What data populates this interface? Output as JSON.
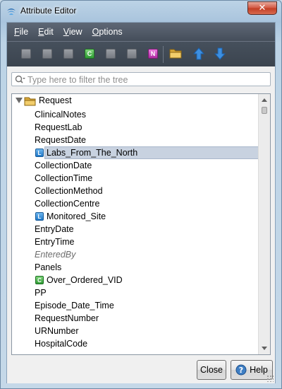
{
  "window": {
    "title": "Attribute Editor",
    "close_glyph": "✕"
  },
  "menu": [
    {
      "underline": "F",
      "rest": "ile"
    },
    {
      "underline": "E",
      "rest": "dit"
    },
    {
      "underline": "V",
      "rest": "iew"
    },
    {
      "underline": "O",
      "rest": "ptions"
    }
  ],
  "toolbar": {
    "green_badge": "C",
    "magenta_badge": "N"
  },
  "filter": {
    "placeholder": "Type here to filter the tree"
  },
  "tree": {
    "root": "Request",
    "items": [
      {
        "label": "ClinicalNotes",
        "icon": ""
      },
      {
        "label": "RequestLab",
        "icon": ""
      },
      {
        "label": "RequestDate",
        "icon": ""
      },
      {
        "label": "Labs_From_The_North",
        "icon": "blue",
        "badge": "L",
        "selected": true
      },
      {
        "label": "CollectionDate",
        "icon": ""
      },
      {
        "label": "CollectionTime",
        "icon": ""
      },
      {
        "label": "CollectionMethod",
        "icon": ""
      },
      {
        "label": "CollectionCentre",
        "icon": ""
      },
      {
        "label": "Monitored_Site",
        "icon": "blue",
        "badge": "L"
      },
      {
        "label": "EntryDate",
        "icon": ""
      },
      {
        "label": "EntryTime",
        "icon": ""
      },
      {
        "label": "EnteredBy",
        "icon": "",
        "italic": true
      },
      {
        "label": "Panels",
        "icon": ""
      },
      {
        "label": "Over_Ordered_VID",
        "icon": "green",
        "badge": "C"
      },
      {
        "label": "PP",
        "icon": ""
      },
      {
        "label": "Episode_Date_Time",
        "icon": ""
      },
      {
        "label": "RequestNumber",
        "icon": ""
      },
      {
        "label": "URNumber",
        "icon": ""
      },
      {
        "label": "HospitalCode",
        "icon": ""
      }
    ]
  },
  "buttons": {
    "close": "Close",
    "help": "Help"
  },
  "colors": {
    "menubar": "#4c5562",
    "selection": "#c8d2e0",
    "link_blue": "#1f78c9"
  }
}
